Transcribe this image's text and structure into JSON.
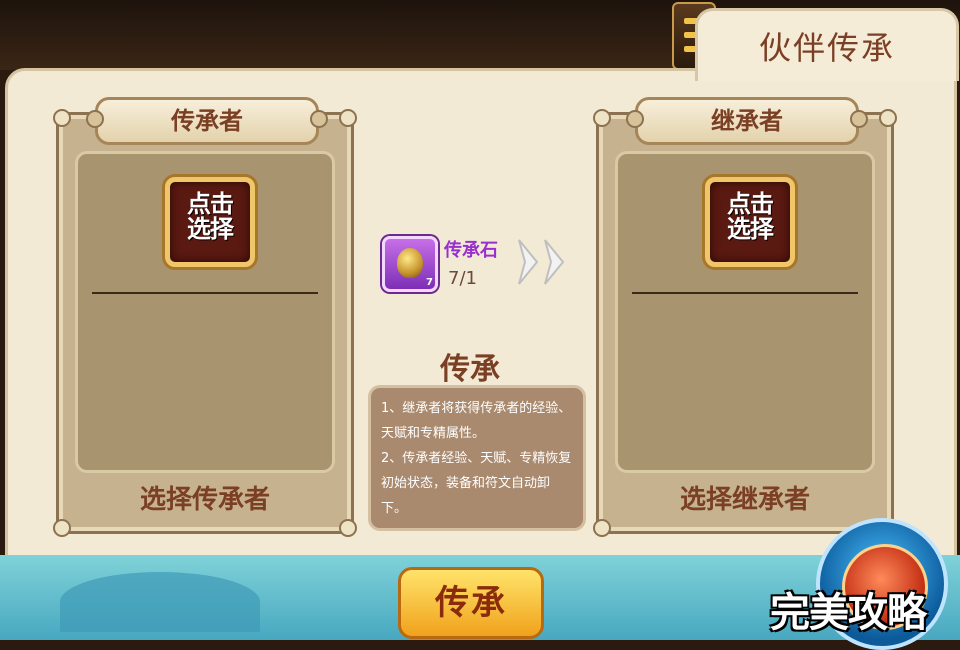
{
  "window": {
    "title": "伙伴传承"
  },
  "left_card": {
    "header": "传承者",
    "select_text": "点击\n选择",
    "footer": "选择传承者"
  },
  "right_card": {
    "header": "继承者",
    "select_text": "点击\n选择",
    "footer": "选择继承者"
  },
  "material": {
    "name": "传承石",
    "count": "7/1",
    "badge": "7",
    "icon": "walnut-stone-icon"
  },
  "info": {
    "title": "传承",
    "line1": "1、继承者将获得传承者的经验、天赋和专精属性。",
    "line2": "2、传承者经验、天赋、专精恢复初始状态，装备和符文自动卸下。"
  },
  "actions": {
    "inherit_label": "传承"
  },
  "watermark": "完美攻略",
  "colors": {
    "title_text": "#7a3f24",
    "material_name": "#9a2fd0",
    "panel_bg": "#f3ead5"
  }
}
